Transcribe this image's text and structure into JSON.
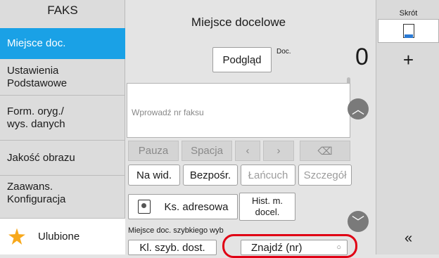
{
  "sidebar": {
    "title": "FAKS",
    "items": [
      {
        "label": "Miejsce doc.",
        "active": true
      },
      {
        "label": "Ustawienia\nPodstawowe"
      },
      {
        "label": "Form. oryg./\nwys. danych"
      },
      {
        "label": "Jakość obrazu"
      },
      {
        "label": "Zaawans.\nKonfiguracja"
      }
    ],
    "favorites": {
      "label": "Ulubione",
      "icon": "star-icon"
    }
  },
  "main": {
    "title": "Miejsce docelowe",
    "preview_label": "Podgląd",
    "doc_label": "Doc.",
    "doc_count": "0",
    "fax_placeholder": "Wprowadź nr faksu",
    "keys": [
      "Pauza",
      "Spacja",
      "‹",
      "›",
      "⌫"
    ],
    "tabs": [
      "Na wid.",
      "Bezpośr.",
      "Łańcuch",
      "Szczegół"
    ],
    "address_book": "Ks. adresowa",
    "history": "Hist. m.\ndocel.",
    "quick_label": "Miejsce doc. szybkiego wyb",
    "quick_button": "Kl. szyb. dost.",
    "find_button": "Znajdź (nr)"
  },
  "right_panel": {
    "shortcut_label": "Skrót",
    "add": "+",
    "collapse": "«"
  },
  "colors": {
    "accent": "#1aa1e6",
    "highlight": "#e00014",
    "star": "#f7a81b"
  }
}
